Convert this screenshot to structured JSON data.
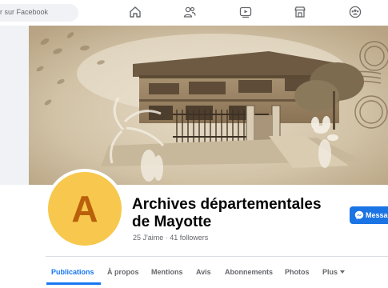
{
  "topbar": {
    "search_text": "r sur Facebook",
    "nav_icons": [
      "home-icon",
      "friends-icon",
      "watch-icon",
      "marketplace-icon",
      "groups-icon"
    ]
  },
  "profile": {
    "avatar_letter": "A",
    "name": "Archives départementales de Mayotte",
    "stats": "25 J'aime · 41 followers",
    "message_button": "Messag"
  },
  "tabs": [
    {
      "label": "Publications",
      "active": true
    },
    {
      "label": "À propos",
      "active": false
    },
    {
      "label": "Mentions",
      "active": false
    },
    {
      "label": "Avis",
      "active": false
    },
    {
      "label": "Abonnements",
      "active": false
    },
    {
      "label": "Photos",
      "active": false
    },
    {
      "label": "Plus",
      "active": false
    }
  ],
  "colors": {
    "accent": "#1877f2",
    "avatar_bg": "#f7c84d",
    "avatar_letter": "#b9600b",
    "cover_tint": "#c9b89c"
  }
}
